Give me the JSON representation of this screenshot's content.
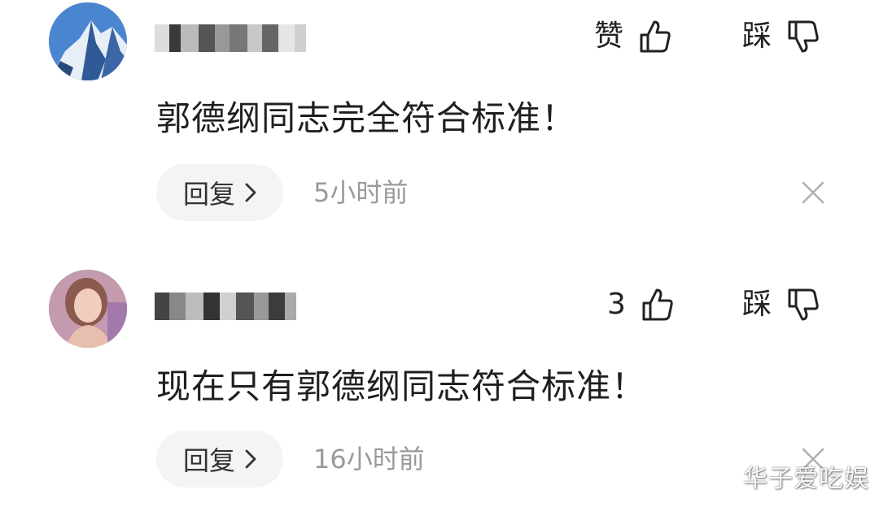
{
  "comments": [
    {
      "avatar": "mountain-avatar",
      "username": "",
      "like_label": "赞",
      "dislike_label": "踩",
      "content": "郭德纲同志完全符合标准！",
      "reply_label": "回复",
      "time": "5小时前"
    },
    {
      "avatar": "woman-avatar",
      "username": "",
      "like_label": "3",
      "dislike_label": "踩",
      "content": "现在只有郭德纲同志符合标准！",
      "reply_label": "回复",
      "time": "16小时前"
    }
  ],
  "icons": {
    "like": "thumbs-up-icon",
    "dislike": "thumbs-down-icon",
    "reply_chevron": "chevron-right-icon",
    "close": "close-icon"
  },
  "colors": {
    "time_text": "#9a9a9a",
    "reply_bg": "#f4f4f4"
  },
  "watermark": "华子爱吃娱"
}
